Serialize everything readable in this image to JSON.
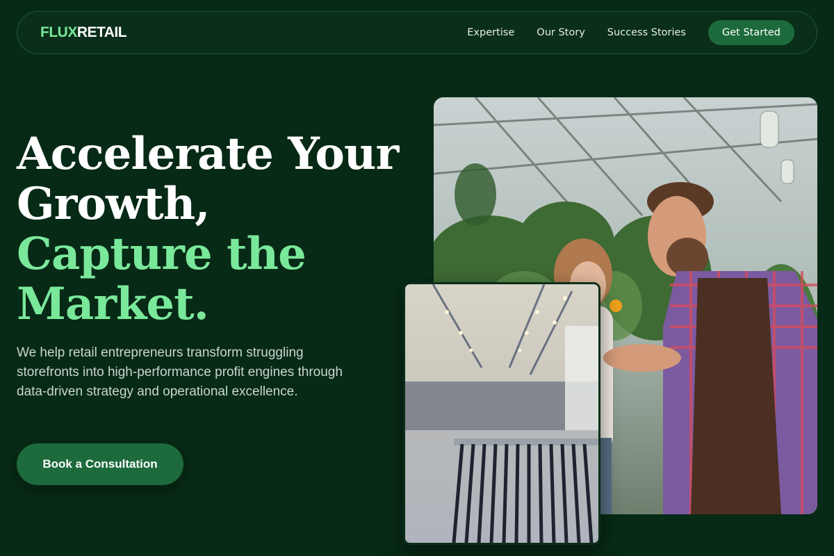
{
  "brand": {
    "prefix": "FLUX",
    "suffix": "RETAIL"
  },
  "nav": {
    "links": [
      "Expertise",
      "Our Story",
      "Success Stories"
    ],
    "cta_label": "Get Started"
  },
  "hero": {
    "headline_white": [
      "Accelerate Your",
      "Growth,"
    ],
    "headline_green": [
      "Capture the",
      "Market."
    ],
    "description": "We help retail entrepreneurs transform struggling storefronts into high-performance profit engines through data-driven strategy and operational excellence.",
    "cta_label": "Book a Consultation"
  },
  "colors": {
    "background": "#072a16",
    "accent_green": "#7ae89a",
    "button_green": "#1d6b3c"
  }
}
